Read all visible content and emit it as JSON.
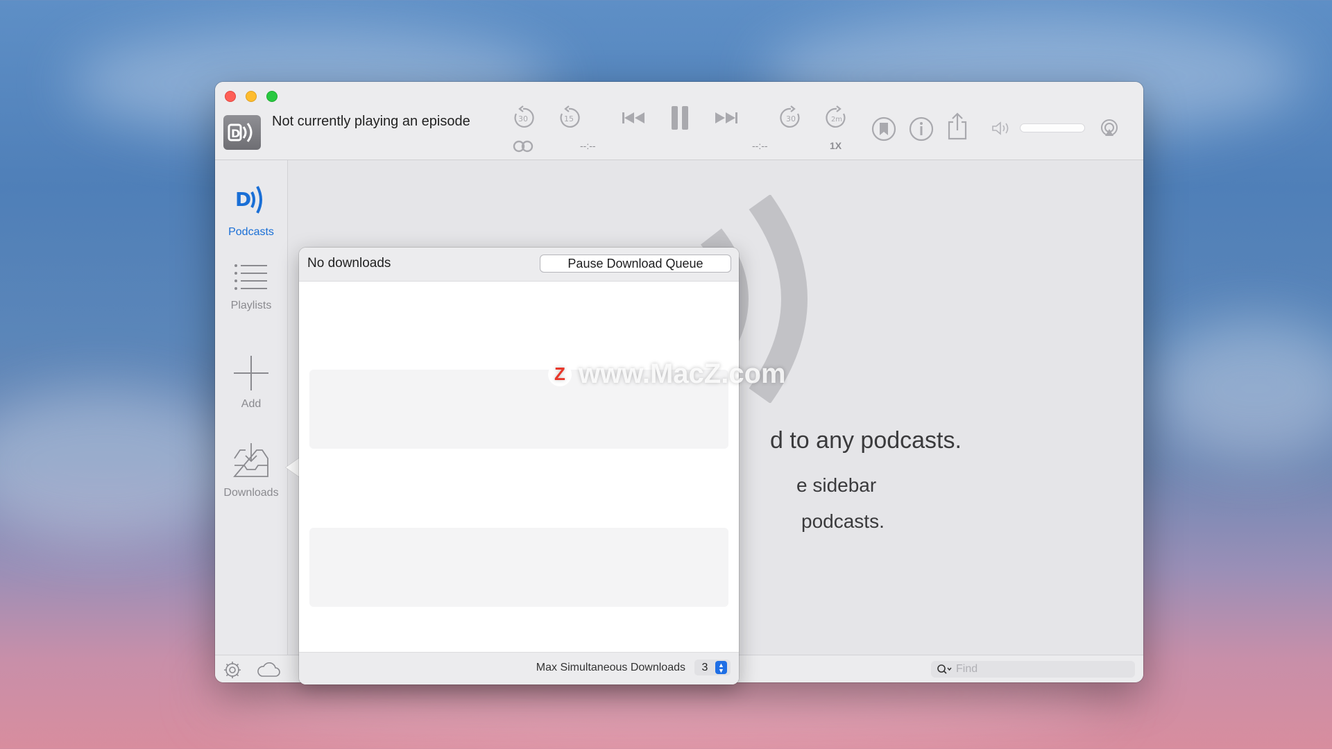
{
  "now_playing": {
    "text": "Not currently playing an episode",
    "elapsed": "--:--",
    "remaining": "--:--",
    "speed": "1X"
  },
  "sidebar": {
    "items": [
      {
        "label": "Podcasts",
        "icon": "podcasts-icon",
        "active": true
      },
      {
        "label": "Playlists",
        "icon": "list-icon",
        "active": false
      },
      {
        "label": "Add",
        "icon": "plus-icon",
        "active": false
      },
      {
        "label": "Downloads",
        "icon": "tray-download-icon",
        "active": false
      }
    ]
  },
  "main": {
    "line1": "d to any podcasts.",
    "line2": "e sidebar",
    "line3": "podcasts."
  },
  "downloads_popover": {
    "title": "No downloads",
    "pause_button": "Pause Download Queue",
    "max_label": "Max Simultaneous Downloads",
    "max_value": "3"
  },
  "search": {
    "placeholder": "Find"
  },
  "watermark": {
    "text": "www.MacZ.com",
    "logo": "Z"
  },
  "colors": {
    "accent": "#1a6fd6",
    "stepper": "#1f6fe5"
  }
}
